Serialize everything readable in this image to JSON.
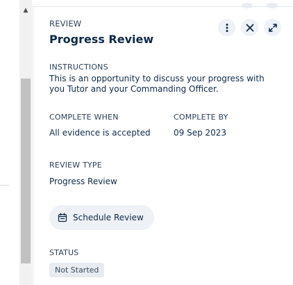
{
  "panel": {
    "eyebrow": "REVIEW",
    "title": "Progress Review",
    "actions": {
      "more_icon": "vertical-ellipsis",
      "close_icon": "close-x",
      "expand_icon": "diagonal-expand-arrows"
    }
  },
  "instructions": {
    "label": "INSTRUCTIONS",
    "text": "This is an opportunity to discuss your progress with you Tutor and your Commanding Officer."
  },
  "complete_when": {
    "label": "COMPLETE WHEN",
    "value": "All evidence is accepted"
  },
  "complete_by": {
    "label": "COMPLETE BY",
    "value": "09 Sep 2023"
  },
  "review_type": {
    "label": "REVIEW TYPE",
    "value": "Progress Review"
  },
  "schedule": {
    "label": "Schedule Review",
    "icon": "calendar-icon"
  },
  "status": {
    "label": "STATUS",
    "value": "Not Started"
  },
  "colors": {
    "text_primary": "#0e2a47",
    "button_bg": "#eef1f5",
    "badge_bg": "#e8ecf0"
  }
}
